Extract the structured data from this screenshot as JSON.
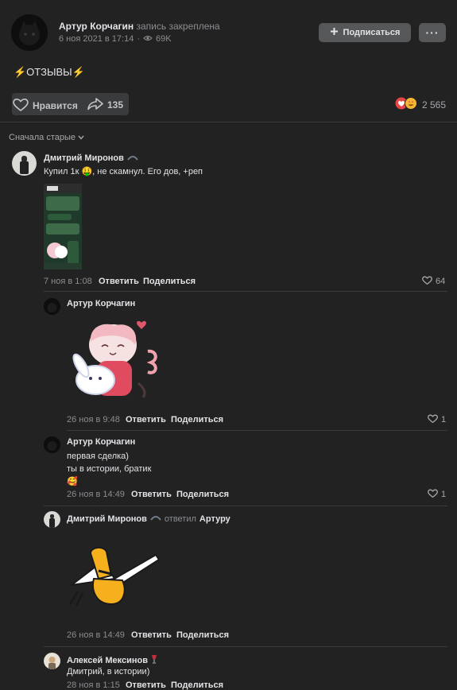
{
  "post": {
    "author": "Артур Корчагин",
    "pinned_note": "запись закреплена",
    "date": "6 ноя 2021 в 17:14",
    "views": "69K",
    "subscribe_label": "Подписаться",
    "more_label": "···",
    "text": "⚡ОТЗЫВЫ⚡",
    "like_label": "Нравится",
    "shares": "135",
    "reactions_count": "2 565"
  },
  "sort": {
    "label": "Сначала старые"
  },
  "comments": [
    {
      "author": "Дмитрий Миронов",
      "text": "Купил 1к 🤑, не скамнул. Его дов, +реп",
      "date": "7 ноя в 1:08",
      "reply_label": "Ответить",
      "share_label": "Поделиться",
      "likes": "64"
    },
    {
      "author": "Артур Корчагин",
      "date": "26 ноя в 9:48",
      "reply_label": "Ответить",
      "share_label": "Поделиться",
      "likes": "1"
    },
    {
      "author": "Артур Корчагин",
      "lines": [
        "первая сделка)",
        "ты в истории, братик",
        "🥰"
      ],
      "date": "26 ноя в 14:49",
      "reply_label": "Ответить",
      "share_label": "Поделиться",
      "likes": "1"
    },
    {
      "author": "Дмитрий Миронов",
      "replied_text": "ответил",
      "replied_to": "Артуру",
      "date": "26 ноя в 14:49",
      "reply_label": "Ответить",
      "share_label": "Поделиться"
    },
    {
      "author": "Алексей Мексинов",
      "text": "Дмитрий, в истории)",
      "date": "28 ноя в 1:15",
      "reply_label": "Ответить",
      "share_label": "Поделиться"
    }
  ],
  "colors": {
    "background": "#222222",
    "button": "#555759",
    "text": "#e1e3e6",
    "muted": "#8a8d91",
    "accent_like": "#e64646"
  }
}
